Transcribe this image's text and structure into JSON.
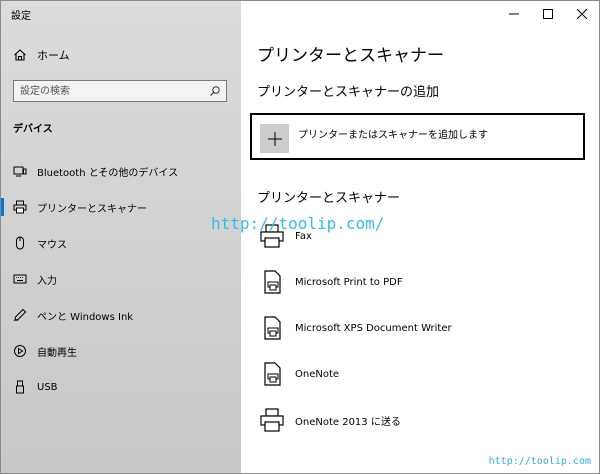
{
  "app": {
    "title": "設定"
  },
  "sidebar": {
    "home_label": "ホーム",
    "search_placeholder": "設定の検索",
    "section_label": "デバイス",
    "items": [
      {
        "label": "Bluetooth とその他のデバイス",
        "icon": "bluetooth-device-icon"
      },
      {
        "label": "プリンターとスキャナー",
        "icon": "printer-icon",
        "active": true
      },
      {
        "label": "マウス",
        "icon": "mouse-icon"
      },
      {
        "label": "入力",
        "icon": "keyboard-icon"
      },
      {
        "label": "ペンと Windows Ink",
        "icon": "pen-icon"
      },
      {
        "label": "自動再生",
        "icon": "autoplay-icon"
      },
      {
        "label": "USB",
        "icon": "usb-icon"
      }
    ]
  },
  "main": {
    "title": "プリンターとスキャナー",
    "add_section_title": "プリンターとスキャナーの追加",
    "add_button_label": "プリンターまたはスキャナーを追加します",
    "list_title": "プリンターとスキャナー",
    "printers": [
      {
        "name": "Fax"
      },
      {
        "name": "Microsoft Print to PDF"
      },
      {
        "name": "Microsoft XPS Document Writer"
      },
      {
        "name": "OneNote"
      },
      {
        "name": "OneNote 2013 に送る"
      }
    ]
  },
  "watermark": {
    "text": "http://toolip.com/",
    "small_text": "http://toolip.com"
  },
  "colors": {
    "accent": "#0078d7",
    "sidebar_bg": "#d4d4d4"
  }
}
